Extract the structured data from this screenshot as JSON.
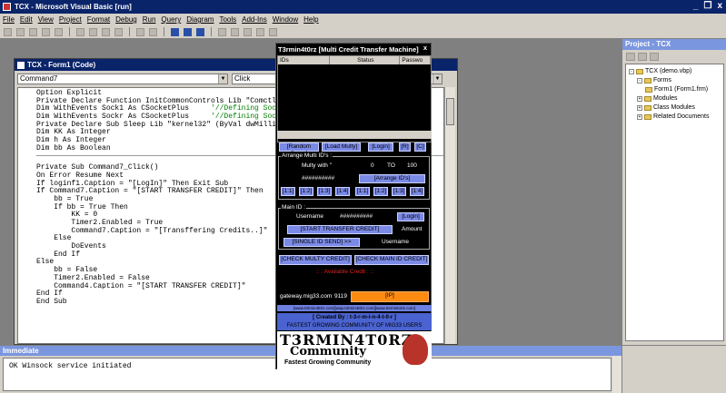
{
  "window": {
    "title": "TCX - Microsoft Visual Basic [run]",
    "controls": [
      "_",
      "❐",
      "x"
    ]
  },
  "menubar": [
    "File",
    "Edit",
    "View",
    "Project",
    "Format",
    "Debug",
    "Run",
    "Query",
    "Diagram",
    "Tools",
    "Add-Ins",
    "Window",
    "Help"
  ],
  "code_window": {
    "title": "TCX - Form1 (Code)",
    "object_combo": "Command7",
    "proc_combo": "Click",
    "lines": [
      {
        "t": "Option Explicit"
      },
      {
        "t": "Private Declare Function InitCommonControls Lib \"Comctl32"
      },
      {
        "t": "Dim WithEvents Sock1 As CSocketPlus     ",
        "c": "'//Defining Socke"
      },
      {
        "t": "Dim WithEvents Sockr As CSocketPlus     ",
        "c": "'//Defining Socke"
      },
      {
        "t": "Private Declare Sub Sleep Lib \"kernel32\" (ByVal dwMillise"
      },
      {
        "t": "Dim KK As Integer"
      },
      {
        "t": "Dim h As Integer"
      },
      {
        "t": "Dim bb As Boolean"
      },
      {
        "sep": true
      },
      {
        "t": ""
      },
      {
        "t": "Private Sub Command7_Click()"
      },
      {
        "t": "On Error Resume Next"
      },
      {
        "t": "If loginf1.Caption = \"[LogIn]\" Then Exit Sub"
      },
      {
        "t": "If Command7.Caption = \"[START TRANSFER CREDIT]\" Then"
      },
      {
        "t": "    bb = True"
      },
      {
        "t": "    If bb = True Then"
      },
      {
        "t": "        KK = 0"
      },
      {
        "t": "        Timer2.Enabled = True"
      },
      {
        "t": "        Command7.Caption = \"[Transffering Credits..]\""
      },
      {
        "t": "    Else"
      },
      {
        "t": "        DoEvents"
      },
      {
        "t": "    End If"
      },
      {
        "t": "Else"
      },
      {
        "t": "    bb = False"
      },
      {
        "t": "    Timer2.Enabled = False"
      },
      {
        "t": "    Command4.Caption = \"[START TRANSFER CREDIT]\""
      },
      {
        "t": "End If"
      },
      {
        "t": "End Sub"
      }
    ]
  },
  "project": {
    "title": "Project - TCX",
    "tree": [
      {
        "label": "TCX (demo.vbp)",
        "level": 0,
        "pm": "-"
      },
      {
        "label": "Forms",
        "level": 1,
        "pm": "-"
      },
      {
        "label": "Form1 (Form1.frm)",
        "level": 2,
        "pm": ""
      },
      {
        "label": "Modules",
        "level": 1,
        "pm": "+"
      },
      {
        "label": "Class Modules",
        "level": 1,
        "pm": "+"
      },
      {
        "label": "Related Documents",
        "level": 1,
        "pm": "+"
      }
    ]
  },
  "immediate": {
    "title": "Immediate",
    "text": "OK Winsock service initiated"
  },
  "tcx_form": {
    "title": "T3rmin4t0rz [Multi Credit Transfer Machine]",
    "close": "x",
    "list_columns": [
      "IDs",
      "Status",
      "Passwo"
    ],
    "row1": [
      "[Random Setup]",
      "[Load Multy]",
      "[Login]",
      "[R]",
      "[C]"
    ],
    "arrange_label": "Arrange Multi ID's :",
    "multy_with": "Multy with \"",
    "multy_from": "0",
    "multy_to_label": "TO",
    "multy_to": "100",
    "hash_text": "##########",
    "arrange_btn": "[Arrange ID's]",
    "step_btns": [
      "[1:1]",
      "[1:2]",
      "[1:3]",
      "[1:4]",
      "[1:1]",
      "[1:2]",
      "[1:3]",
      "[1:4]"
    ],
    "main_label": "Main ID :",
    "username_label": "Username",
    "main_hash": "##########",
    "login_btn": "[Login]",
    "start_btn": "[START TRANSFER CREDIT]",
    "amount_label": "Amount",
    "single_btn": "[SINGLE ID SEND] >>",
    "username2": "Username",
    "check_multy": "[CHECK MULTY CREDIT]",
    "check_main": "[CHECK MAIN ID CREDIT]",
    "available": ":: : Available Credit : ::",
    "gateway": "gateway.mig33.com",
    "port": "9119",
    "ip_btn": "[IP]",
    "links": "[www.t3rmin4t0rz.com][wap.t3rmin4t0rz.com][www.termintortz.com]",
    "created_by": "[ Created By : t-3-r-m-i-n-4-t-0-r ]",
    "community_line": "FASTEST GROWING COMMUNITY OF MIG33 USERS",
    "logo_line1": "T3RMIN4T0RZ",
    "logo_line2": "Community",
    "logo_line3": "Fastest Growing Community"
  }
}
